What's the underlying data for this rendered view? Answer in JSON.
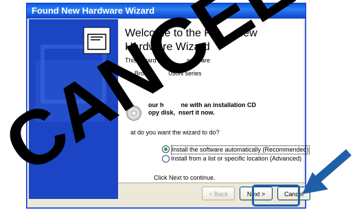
{
  "window": {
    "title": "Found New Hardware Wizard"
  },
  "wizard": {
    "heading_line1": "Welcome to the Fo",
    "heading_line1_end": "New",
    "heading_line2": "Hardware Wizard",
    "intro_start": "This wizard hel",
    "intro_end": "software",
    "device_start": "Brother",
    "device_end": "050N series",
    "cd_line1_start": "our h",
    "cd_line1_end": "ne with an installation CD",
    "cd_line2_start": "opy disk,",
    "cd_line2_end": "nsert it now.",
    "question": "at do you want the wizard to do?",
    "options": [
      "Install the software automatically (Recommended)",
      "Install from a list or specific location (Advanced)"
    ],
    "footer": "Click Next to continue."
  },
  "buttons": {
    "back": "< Back",
    "next": "Next >",
    "cancel": "Cancel"
  },
  "overlay": {
    "text": "CANCEL",
    "color": "#000000",
    "arrow_color": "#1e5fa8"
  }
}
